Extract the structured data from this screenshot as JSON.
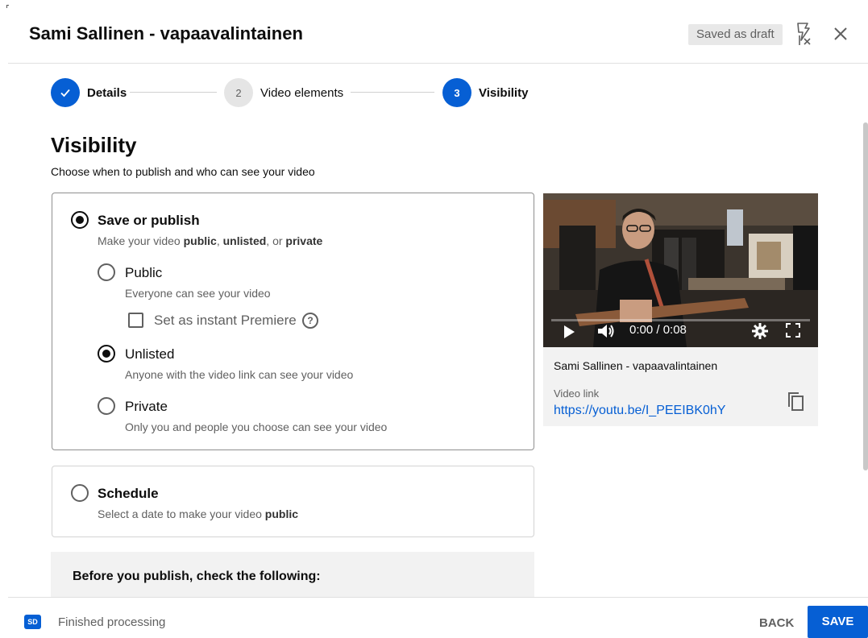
{
  "header": {
    "title": "Sami Sallinen - vapaavalintainen",
    "draft_badge": "Saved as draft",
    "feedback_icon": "feedback-flag-icon",
    "close_icon": "close-icon"
  },
  "stepper": {
    "steps": [
      {
        "number": "",
        "label": "Details",
        "state": "done"
      },
      {
        "number": "2",
        "label": "Video elements",
        "state": "todo"
      },
      {
        "number": "3",
        "label": "Visibility",
        "state": "active"
      }
    ]
  },
  "visibility": {
    "title": "Visibility",
    "subtitle": "Choose when to publish and who can see your video",
    "save_or_publish": {
      "title": "Save or publish",
      "desc_prefix": "Make your video ",
      "desc_public": "public",
      "desc_sep1": ", ",
      "desc_unlisted": "unlisted",
      "desc_sep2": ", or ",
      "desc_private": "private",
      "selected": true
    },
    "options": [
      {
        "key": "public",
        "label": "Public",
        "desc": "Everyone can see your video",
        "selected": false
      },
      {
        "key": "unlisted",
        "label": "Unlisted",
        "desc": "Anyone with the video link can see your video",
        "selected": true
      },
      {
        "key": "private",
        "label": "Private",
        "desc": "Only you and people you choose can see your video",
        "selected": false
      }
    ],
    "premiere": {
      "label": "Set as instant Premiere",
      "checked": false,
      "help": "?"
    },
    "schedule": {
      "title": "Schedule",
      "desc_prefix": "Select a date to make your video ",
      "desc_bold": "public",
      "selected": false
    },
    "checklist_title": "Before you publish, check the following:"
  },
  "preview": {
    "time": "0:00 / 0:08",
    "progress": 0,
    "video_title": "Sami Sallinen - vapaavalintainen",
    "link_label": "Video link",
    "link_url": "https://youtu.be/I_PEEIBK0hY"
  },
  "footer": {
    "sd_badge": "SD",
    "status": "Finished processing",
    "back": "BACK",
    "save": "SAVE"
  },
  "colors": {
    "accent": "#065fd4",
    "text": "#0d0d0d",
    "muted": "#606060"
  }
}
